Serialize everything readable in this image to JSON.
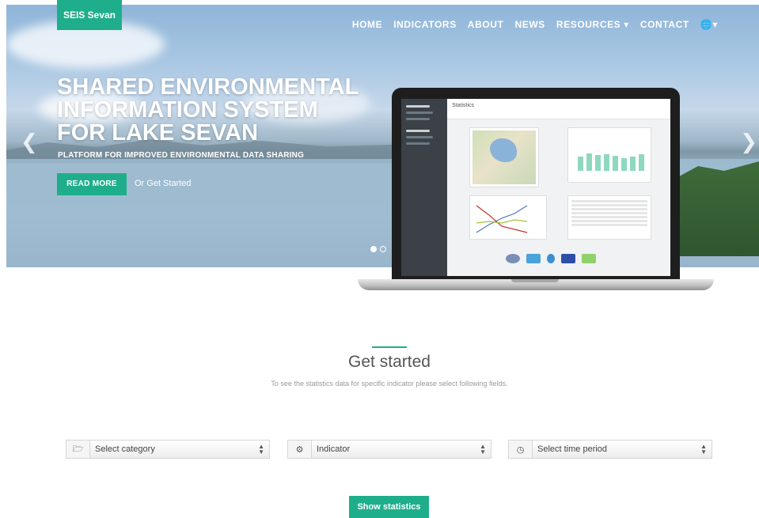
{
  "brand": "SEIS Sevan",
  "nav": {
    "items": [
      "HOME",
      "INDICATORS",
      "ABOUT",
      "NEWS",
      "RESOURCES ▾",
      "CONTACT"
    ],
    "language_icon": "globe-icon"
  },
  "hero": {
    "title_lines": [
      "SHARED ENVIRONMENTAL",
      "INFORMATION SYSTEM",
      "FOR LAKE SEVAN"
    ],
    "subtitle": "PLATFORM FOR IMPROVED ENVIRONMENTAL DATA SHARING",
    "read_more": "READ MORE",
    "or_get_started": "Or Get Started",
    "prev_icon": "chevron-left-icon",
    "next_icon": "chevron-right-icon",
    "active_slide": 1,
    "slide_count": 2
  },
  "screenshot_app": {
    "title": "Statistics"
  },
  "get_started": {
    "title": "Get started",
    "subtitle": "To see the statistics data for specific indicator please select following fields.",
    "fields": [
      {
        "icon": "folder-icon",
        "placeholder": "Select category"
      },
      {
        "icon": "gears-icon",
        "placeholder": "Indicator"
      },
      {
        "icon": "clock-icon",
        "placeholder": "Select time period"
      }
    ],
    "show_button": "Show statistics"
  },
  "colors": {
    "accent": "#1fae8b"
  }
}
